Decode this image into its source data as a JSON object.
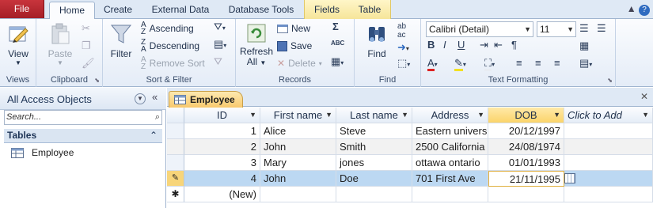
{
  "ribbon_tabs": [
    "File",
    "Home",
    "Create",
    "External Data",
    "Database Tools",
    "Fields",
    "Table"
  ],
  "active_tab": "Home",
  "groups": {
    "views": {
      "label": "Views",
      "view": "View"
    },
    "clipboard": {
      "label": "Clipboard",
      "paste": "Paste"
    },
    "sort_filter": {
      "label": "Sort & Filter",
      "filter": "Filter",
      "ascending": "Ascending",
      "descending": "Descending",
      "remove_sort": "Remove Sort"
    },
    "records": {
      "label": "Records",
      "refresh_line1": "Refresh",
      "refresh_line2": "All",
      "new": "New",
      "save": "Save",
      "delete": "Delete",
      "sigma": "Σ",
      "abc": "ABC"
    },
    "find": {
      "label": "Find",
      "find": "Find"
    },
    "text_formatting": {
      "label": "Text Formatting",
      "font": "Calibri (Detail)",
      "size": "11"
    }
  },
  "nav": {
    "title": "All Access Objects",
    "search_placeholder": "Search...",
    "group": "Tables",
    "items": [
      "Employee"
    ]
  },
  "document_tab": "Employee",
  "table": {
    "columns": [
      "ID",
      "First name",
      "Last name",
      "Address",
      "DOB",
      "Click to Add"
    ],
    "rows": [
      {
        "selector": "",
        "id": "1",
        "first": "Alice",
        "last": "Steve",
        "address": "Eastern univers",
        "dob": "20/12/1997"
      },
      {
        "selector": "",
        "id": "2",
        "first": "John",
        "last": "Smith",
        "address": "2500 California",
        "dob": "24/08/1974"
      },
      {
        "selector": "",
        "id": "3",
        "first": "Mary",
        "last": "jones",
        "address": "ottawa ontario",
        "dob": "01/01/1993"
      },
      {
        "selector": "✎",
        "id": "4",
        "first": "John",
        "last": "Doe",
        "address": "701 First Ave",
        "dob": "21/11/1995"
      }
    ],
    "new_row_selector": "✱",
    "new_row_label": "(New)"
  },
  "colors": {
    "file_tab": "#b3262e",
    "selected_row": "#bcd8f2",
    "dob_header": "#fbd46a",
    "doc_tab": "#f8c96d"
  }
}
